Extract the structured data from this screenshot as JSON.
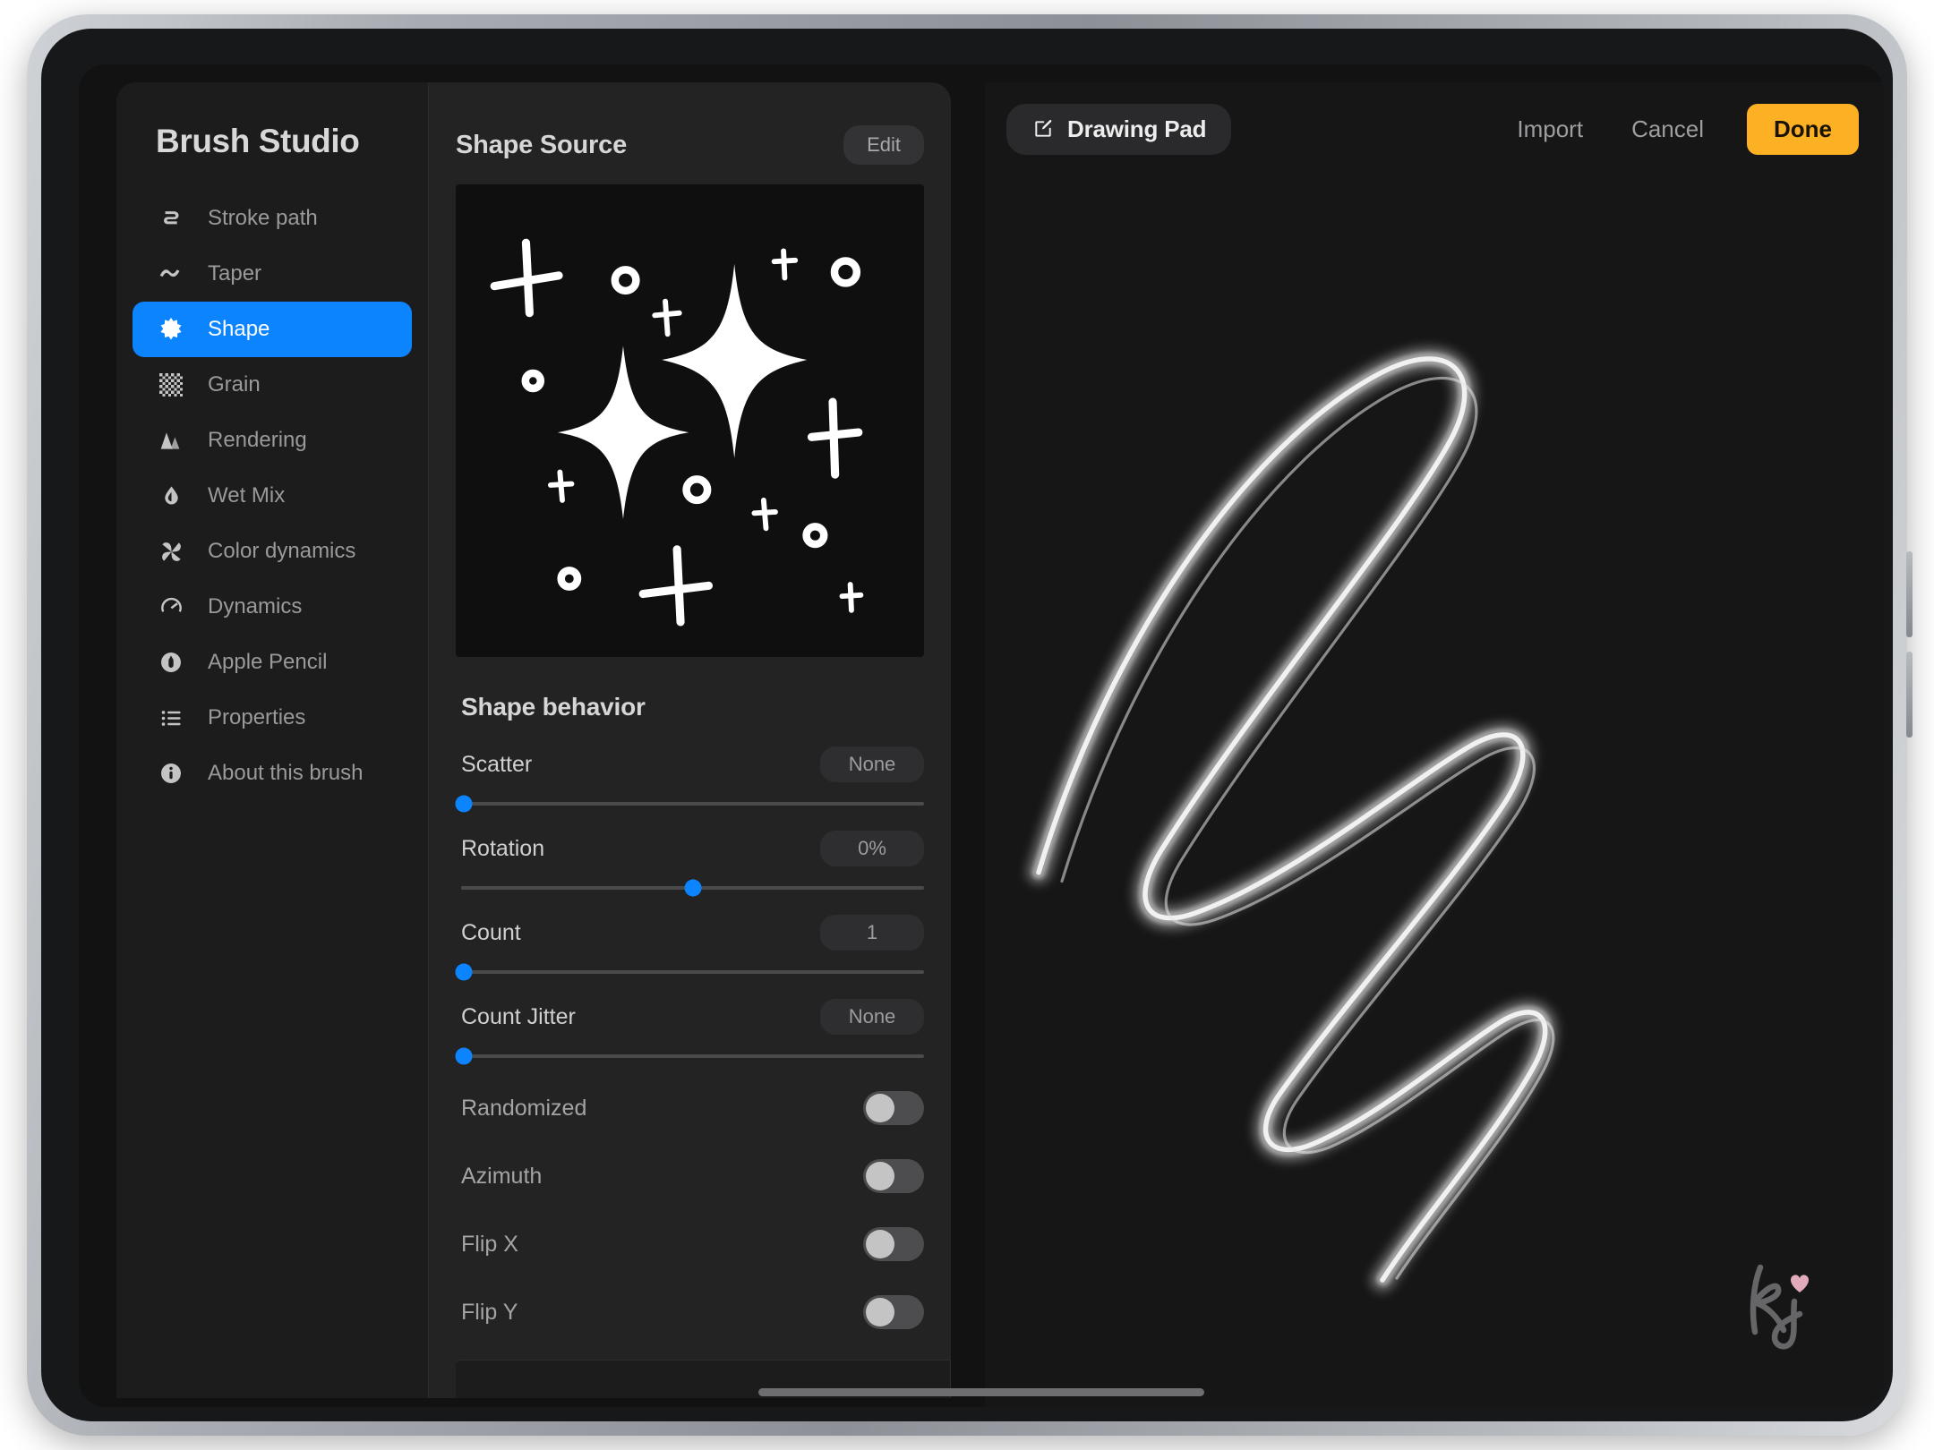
{
  "app": {
    "modal_title": "Brush Studio"
  },
  "sidebar": {
    "items": [
      {
        "label": "Stroke path",
        "icon": "stroke-path-icon",
        "active": false
      },
      {
        "label": "Taper",
        "icon": "taper-icon",
        "active": false
      },
      {
        "label": "Shape",
        "icon": "shape-star-icon",
        "active": true
      },
      {
        "label": "Grain",
        "icon": "grain-icon",
        "active": false
      },
      {
        "label": "Rendering",
        "icon": "rendering-icon",
        "active": false
      },
      {
        "label": "Wet Mix",
        "icon": "water-drop-icon",
        "active": false
      },
      {
        "label": "Color dynamics",
        "icon": "pinwheel-icon",
        "active": false
      },
      {
        "label": "Dynamics",
        "icon": "speedometer-icon",
        "active": false
      },
      {
        "label": "Apple Pencil",
        "icon": "apple-pencil-icon",
        "active": false
      },
      {
        "label": "Properties",
        "icon": "list-icon",
        "active": false
      },
      {
        "label": "About this brush",
        "icon": "info-icon",
        "active": false
      }
    ]
  },
  "shape_source": {
    "title": "Shape Source",
    "edit_label": "Edit",
    "preview_alt": "sparkles-shape-stamp"
  },
  "shape_behavior": {
    "title": "Shape behavior",
    "sliders": [
      {
        "label": "Scatter",
        "value": "None",
        "fill": 0,
        "centered": false
      },
      {
        "label": "Rotation",
        "value": "0%",
        "fill": 50,
        "centered": true
      },
      {
        "label": "Count",
        "value": "1",
        "fill": 0,
        "centered": false
      },
      {
        "label": "Count Jitter",
        "value": "None",
        "fill": 0,
        "centered": false
      }
    ],
    "toggles": [
      {
        "label": "Randomized",
        "on": false
      },
      {
        "label": "Azimuth",
        "on": false
      },
      {
        "label": "Flip X",
        "on": false
      },
      {
        "label": "Flip Y",
        "on": false
      }
    ]
  },
  "topbar": {
    "drawing_pad_label": "Drawing Pad",
    "drawing_pad_icon": "pencil-square-icon",
    "import_label": "Import",
    "cancel_label": "Cancel",
    "done_label": "Done"
  },
  "canvas": {
    "stroke_alt": "zigzag-brush-stroke",
    "watermark_alt": "kj-heart-watermark"
  },
  "colors": {
    "accent_blue": "#0b84fe",
    "done_amber": "#fcb023",
    "panel_bg": "#232324",
    "sidebar_bg": "#1c1c1d",
    "canvas_bg": "#161617",
    "heart_pink": "#f4b8c8"
  }
}
